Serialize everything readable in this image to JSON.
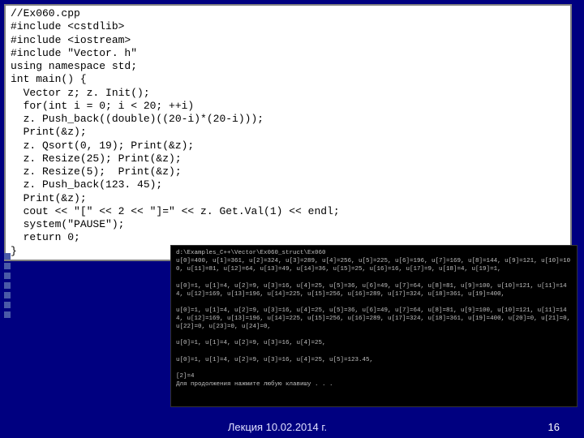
{
  "code": {
    "l1": "//Ex060.cpp",
    "l2": "#include <cstdlib>",
    "l3": "#include <iostream>",
    "l4": "#include \"Vector. h\"",
    "l5": "using namespace std;",
    "l6": "int main() {",
    "l7": "  Vector z; z. Init();",
    "l8": "  for(int i = 0; i < 20; ++i)",
    "l9": "  z. Push_back((double)((20-i)*(20-i)));",
    "l10": "  Print(&z);",
    "l11": "  z. Qsort(0, 19); Print(&z);",
    "l12": "  z. Resize(25); Print(&z);",
    "l13": "  z. Resize(5);  Print(&z);",
    "l14": "  z. Push_back(123. 45);",
    "l15": "  Print(&z);",
    "l16": "  cout << \"[\" << 2 << \"]=\" << z. Get.Val(1) << endl;",
    "l17": "  system(\"PAUSE\");",
    "l18": "  return 0;",
    "l19": "}"
  },
  "console": {
    "l1": "d:\\Examples_C++\\Vector\\Ex060_struct\\Ex060",
    "l2": "u[0]=400, u[1]=361, u[2]=324, u[3]=289, u[4]=256, u[5]=225, u[6]=196, u[7]=169, u[8]=144, u[9]=121, u[10]=100, u[11]=81, u[12]=64, u[13]=49, u[14]=36, u[15]=25, u[16]=16, u[17]=9, u[18]=4, u[19]=1,",
    "l3": "",
    "l4": "u[0]=1, u[1]=4, u[2]=9, u[3]=16, u[4]=25, u[5]=36, u[6]=49, u[7]=64, u[8]=81, u[9]=100, u[10]=121, u[11]=144, u[12]=169, u[13]=196, u[14]=225, u[15]=256, u[16]=289, u[17]=324, u[18]=361, u[19]=400,",
    "l5": "",
    "l6": "u[0]=1, u[1]=4, u[2]=9, u[3]=16, u[4]=25, u[5]=36, u[6]=49, u[7]=64, u[8]=81, u[9]=100, u[10]=121, u[11]=144, u[12]=169, u[13]=196, u[14]=225, u[15]=256, u[16]=289, u[17]=324, u[18]=361, u[19]=400, u[20]=0, u[21]=0, u[22]=0, u[23]=0, u[24]=0,",
    "l7": "",
    "l8": "u[0]=1, u[1]=4, u[2]=9, u[3]=16, u[4]=25,",
    "l9": "",
    "l10": "u[0]=1, u[1]=4, u[2]=9, u[3]=16, u[4]=25, u[5]=123.45,",
    "l11": "",
    "l12": "[2]=4",
    "l13": "Для продолжения нажмите любую клавишу . . ."
  },
  "footer": {
    "date": "Лекция 10.02.2014 г.",
    "page": "16"
  }
}
